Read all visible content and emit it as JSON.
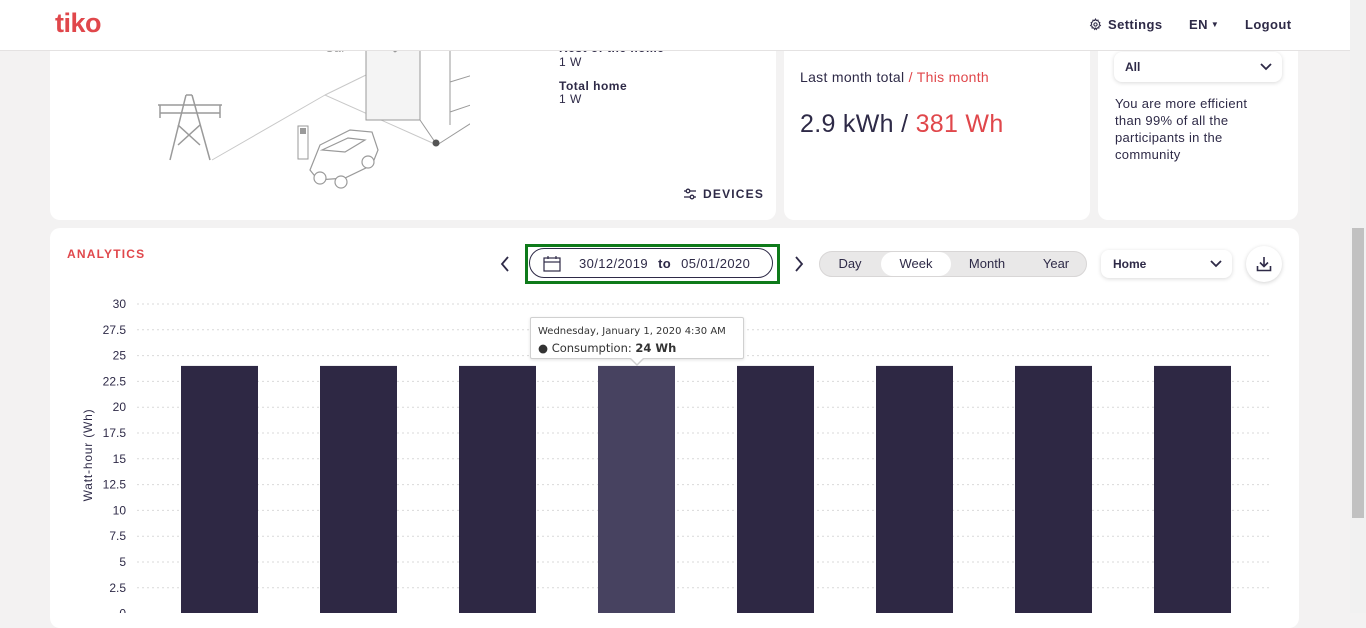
{
  "header": {
    "logo": "tiko",
    "settings_label": "Settings",
    "language_label": "EN",
    "logout_label": "Logout"
  },
  "home_card": {
    "partial_label_1": "Car",
    "rest_label": "Rest of the home",
    "rest_value": "1 W",
    "total_label": "Total home",
    "total_value": "1 W",
    "devices_label": "DEVICES"
  },
  "total_card": {
    "last_month_label": "Last month total",
    "separator": "/",
    "this_month_label": "This month",
    "last_month_value": "2.9 kWh",
    "this_month_value": "381 Wh"
  },
  "community_card": {
    "filter_value": "All",
    "message": "You are more efficient than 99% of all the participants in the community"
  },
  "analytics": {
    "title": "ANALYTICS",
    "date_from": "30/12/2019",
    "date_to_word": "to",
    "date_to": "05/01/2020",
    "periods": [
      "Day",
      "Week",
      "Month",
      "Year"
    ],
    "active_period": "Week",
    "scope_value": "Home",
    "tooltip": {
      "date": "Wednesday, January 1, 2020 4:30 AM",
      "series": "Consumption:",
      "value": "24 Wh"
    }
  },
  "chart_data": {
    "type": "bar",
    "ylabel": "Watt-hour (Wh)",
    "yticks": [
      "30",
      "27.5",
      "25",
      "22.5",
      "20",
      "17.5",
      "15",
      "12.5",
      "10",
      "7.5",
      "5",
      "2.5",
      "0"
    ],
    "ylim": [
      0,
      30
    ],
    "values": [
      24,
      24,
      24,
      24,
      24,
      24,
      24,
      24
    ],
    "highlighted_index": 3,
    "bar_color": "#2e2844",
    "highlight_color": "#474260",
    "grid": "horizontal dotted"
  },
  "colors": {
    "accent": "#e0474b",
    "text": "#2e2a47",
    "focus_outline": "#0e7a1a"
  }
}
